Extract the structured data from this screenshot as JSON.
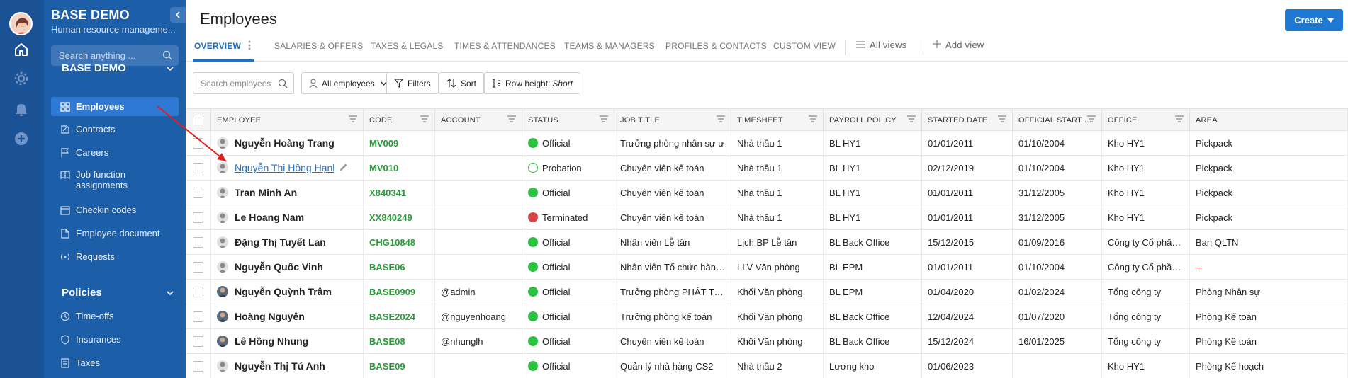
{
  "app": {
    "name": "BASE DEMO",
    "subtitle": "Human resource manageme...",
    "search_placeholder": "Search anything ..."
  },
  "sidebar": {
    "section_main": "BASE DEMO",
    "items": [
      {
        "label": "Employees",
        "icon": "grid-icon"
      },
      {
        "label": "Contracts",
        "icon": "contract-icon"
      },
      {
        "label": "Careers",
        "icon": "flag-icon"
      },
      {
        "label": "Job function",
        "label2": "assignments",
        "icon": "book-icon"
      },
      {
        "label": "Checkin codes",
        "icon": "calendar-icon"
      },
      {
        "label": "Employee document",
        "icon": "document-icon"
      },
      {
        "label": "Requests",
        "icon": "broadcast-icon"
      }
    ],
    "section_policies": "Policies",
    "policies": [
      {
        "label": "Time-offs",
        "icon": "clock-icon"
      },
      {
        "label": "Insurances",
        "icon": "shield-icon"
      },
      {
        "label": "Taxes",
        "icon": "receipt-icon"
      }
    ]
  },
  "page": {
    "title": "Employees",
    "create_label": "Create"
  },
  "tabs": [
    "OVERVIEW",
    "SALARIES & OFFERS",
    "TAXES & LEGALS",
    "TIMES & ATTENDANCES",
    "TEAMS & MANAGERS",
    "PROFILES & CONTACTS",
    "CUSTOM VIEW"
  ],
  "views": {
    "all_views": "All views",
    "add_view": "Add view"
  },
  "toolbar": {
    "search_placeholder": "Search employees",
    "all_employees": "All employees",
    "filters": "Filters",
    "sort": "Sort",
    "row_height_label": "Row height: ",
    "row_height_value": "Short"
  },
  "table": {
    "columns": [
      "EMPLOYEE",
      "CODE",
      "ACCOUNT",
      "STATUS",
      "JOB TITLE",
      "TIMESHEET",
      "PAYROLL POLICY",
      "STARTED DATE",
      "OFFICIAL START ...",
      "OFFICE",
      "AREA"
    ],
    "rows": [
      {
        "name": "Nguyễn Hoàng Trang",
        "code": "MV009",
        "account": "",
        "status": "Official",
        "job": "Trưởng phòng nhân sự ư",
        "timesheet": "Nhà thầu 1",
        "payroll": "BL HY1",
        "started": "01/01/2011",
        "official": "01/10/2004",
        "office": "Kho HY1",
        "area": "Pickpack"
      },
      {
        "name": "Nguyễn Thị Hồng Hạnh",
        "code": "MV010",
        "account": "",
        "status": "Probation",
        "job": "Chuyên viên kế toán",
        "timesheet": "Nhà thầu 1",
        "payroll": "BL HY1",
        "started": "02/12/2019",
        "official": "01/10/2004",
        "office": "Kho HY1",
        "area": "Pickpack"
      },
      {
        "name": "Tran Minh An",
        "code": "X840341",
        "account": "",
        "status": "Official",
        "job": "Chuyên viên kế toán",
        "timesheet": "Nhà thầu 1",
        "payroll": "BL HY1",
        "started": "01/01/2011",
        "official": "31/12/2005",
        "office": "Kho HY1",
        "area": "Pickpack"
      },
      {
        "name": "Le Hoang Nam",
        "code": "XX840249",
        "account": "",
        "status": "Terminated",
        "job": "Chuyên viên kế toán",
        "timesheet": "Nhà thầu 1",
        "payroll": "BL HY1",
        "started": "01/01/2011",
        "official": "31/12/2005",
        "office": "Kho HY1",
        "area": "Pickpack"
      },
      {
        "name": "Đặng Thị Tuyết Lan",
        "code": "CHG10848",
        "account": "",
        "status": "Official",
        "job": "Nhân viên Lễ tân",
        "timesheet": "Lịch BP Lễ tân",
        "payroll": "BL Back Office",
        "started": "15/12/2015",
        "official": "01/09/2016",
        "office": "Công ty Cổ phần Quản...",
        "area": "Ban QLTN"
      },
      {
        "name": "Nguyễn Quốc Vinh",
        "code": "BASE06",
        "account": "",
        "status": "Official",
        "job": "Nhân viên Tổ chức hành chính",
        "timesheet": "LLV Văn phòng",
        "payroll": "BL EPM",
        "started": "01/01/2011",
        "official": "01/10/2004",
        "office": "Công ty Cổ phần Đầu t...",
        "area": "--"
      },
      {
        "name": "Nguyễn Quỳnh Trâm",
        "code": "BASE0909",
        "account": "@admin",
        "status": "Official",
        "job": "Trưởng phòng PHÁT TRIỂN Đ...",
        "timesheet": "Khối Văn phòng",
        "payroll": "BL EPM",
        "started": "01/04/2020",
        "official": "01/02/2024",
        "office": "Tổng công ty",
        "area": "Phòng Nhân sự"
      },
      {
        "name": "Hoàng Nguyên",
        "code": "BASE2024",
        "account": "@nguyenhoang",
        "status": "Official",
        "job": "Trưởng phòng kế toán",
        "timesheet": "Khối Văn phòng",
        "payroll": "BL Back Office",
        "started": "12/04/2024",
        "official": "01/07/2020",
        "office": "Tổng công ty",
        "area": "Phòng Kế toán"
      },
      {
        "name": "Lê Hồng Nhung",
        "code": "BASE08",
        "account": "@nhunglh",
        "status": "Official",
        "job": "Chuyên viên kế toán",
        "timesheet": "Khối Văn phòng",
        "payroll": "BL Back Office",
        "started": "15/12/2024",
        "official": "16/01/2025",
        "office": "Tổng công ty",
        "area": "Phòng Kế toán"
      },
      {
        "name": "Nguyễn Thị Tú Anh",
        "code": "BASE09",
        "account": "",
        "status": "Official",
        "job": "Quản lý nhà hàng CS2",
        "timesheet": "Nhà thầu 2",
        "payroll": "Lương kho",
        "started": "01/06/2023",
        "official": "",
        "office": "Kho HY1",
        "area": "Phòng Kế hoạch"
      }
    ]
  },
  "colors": {
    "rail": "#1b5296",
    "sidebar": "#1d5ea8",
    "active_item": "#2d79d4",
    "primary": "#1f78d1",
    "official": "#2ec243",
    "terminated": "#d64545",
    "code_green": "#2a9a3a",
    "annotation_arrow": "#e02020"
  }
}
